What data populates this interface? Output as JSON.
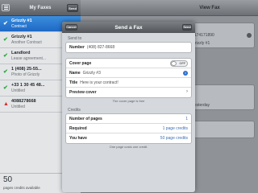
{
  "sidebar": {
    "title": "My Faxes",
    "button": "Send",
    "items": [
      {
        "name": "Grizzly #1",
        "sub": "Contract",
        "status": "✔",
        "selected": true
      },
      {
        "name": "Grizzly #1",
        "sub": "Another Contract",
        "status": "✔"
      },
      {
        "name": "Landlord",
        "sub": "Lease agreement...",
        "status": "✔"
      },
      {
        "name": "1 (408) 25-55...",
        "sub": "Photo of Grizzly",
        "status": "✔"
      },
      {
        "name": "+33 1 30 45 48...",
        "sub": "Untitled",
        "status": "✔"
      },
      {
        "name": "4088278668",
        "sub": "Untitled",
        "status": "▲",
        "error": true
      }
    ],
    "footer_count": "50",
    "footer_label": "pages credits available"
  },
  "detail": {
    "title": "View Fax",
    "values": [
      "",
      "2174171890",
      "Grizzly #1",
      "",
      "",
      "Yesterday",
      "",
      ""
    ]
  },
  "modal": {
    "title": "Send a Fax",
    "cancel": "Cancel",
    "send": "Send",
    "send_to_header": "Send to",
    "number_label": "Number",
    "number_value": "(408) 827-8668",
    "cover_page_label": "Cover page",
    "cover_toggle": "OFF",
    "name_label": "Name",
    "name_value": "Grizzly #3",
    "title_label": "Title",
    "title_value": "Here is your contract!",
    "preview_label": "Preview cover",
    "cover_note": "The cover page is free",
    "credits_header": "Credits",
    "pages_label": "Number of pages",
    "pages_value": "1",
    "required_label": "Required",
    "required_value": "1 page credits",
    "have_label": "You have",
    "have_value": "50 page credits",
    "credit_note": "One page costs one credit."
  }
}
